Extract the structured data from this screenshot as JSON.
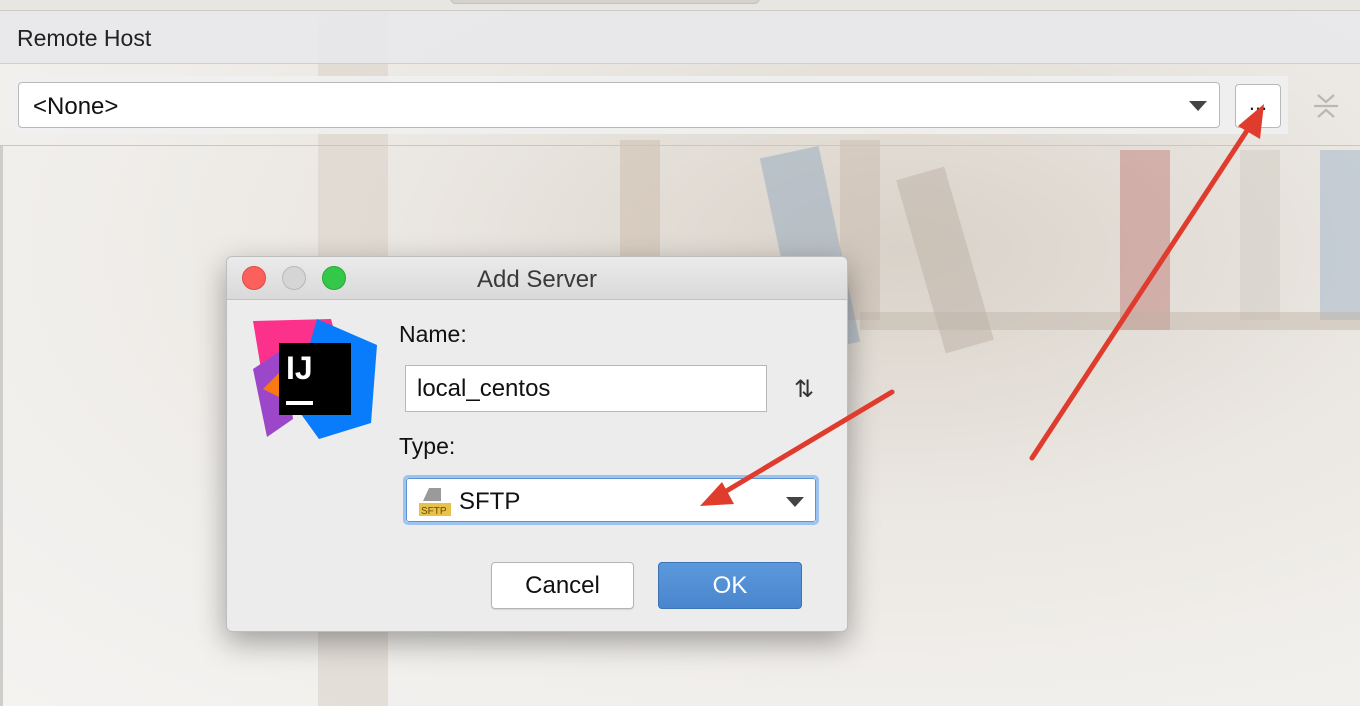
{
  "panel": {
    "title": "Remote Host",
    "host_combo": {
      "value": "<None>"
    },
    "browse_button_label": "..."
  },
  "dialog": {
    "title": "Add Server",
    "name_label": "Name:",
    "name_value": "local_centos",
    "type_label": "Type:",
    "type_value": "SFTP",
    "sftp_icon_text": "SFTP",
    "logo_text": "IJ",
    "cancel_label": "Cancel",
    "ok_label": "OK"
  },
  "icons": {
    "browse": "ellipsis-icon",
    "collapse": "collapse-icon",
    "sort": "sort-arrows-icon",
    "type": "sftp-icon",
    "logo": "intellij-logo-icon"
  },
  "colors": {
    "ok_button": "#4a86cd",
    "focus_ring": "#9cc3ef",
    "annotation_arrow": "#e03c2e",
    "traffic_close": "#fc605c",
    "traffic_max": "#34c84a"
  }
}
